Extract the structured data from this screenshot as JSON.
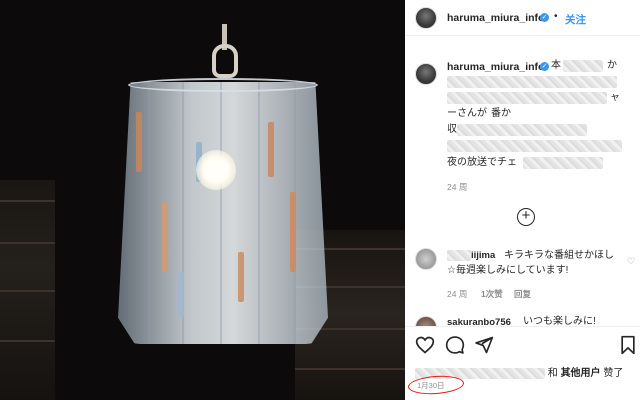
{
  "post": {
    "image_desc_icon": "lamp-photo",
    "header": {
      "username": "haruma_miura_info",
      "separator": "•",
      "follow_label": "关注"
    },
    "caption": {
      "username": "haruma_miura_info",
      "visible_fragments": [
        "本",
        "か",
        "ャ",
        "ーさんが",
        "番か",
        "収",
        "夜の放送でチェ"
      ],
      "time": "24 周"
    },
    "load_more_icon": "plus-circle-icon",
    "comments": [
      {
        "username_fragment": "iijima",
        "text_line1": "キラキラな番組せかほし",
        "text_line2": "☆毎週楽しみにしています!",
        "time": "24 周",
        "likes": "1次赞",
        "reply": "回复"
      },
      {
        "username_fragment": "sakuranbo756",
        "text_line1": "いつも楽しみに!"
      }
    ],
    "actions": {
      "liked_by_suffix": "和",
      "others_label": "其他用户",
      "liked_label": "赞了",
      "date": "1月30日"
    },
    "annotation_color": "#e21b1b",
    "accent_color": "#3897f0"
  }
}
